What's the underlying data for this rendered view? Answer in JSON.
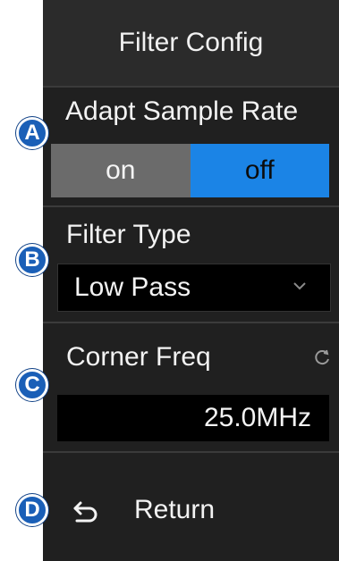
{
  "header": {
    "title": "Filter Config"
  },
  "markers": {
    "a": "A",
    "b": "B",
    "c": "C",
    "d": "D"
  },
  "adapt_sample_rate": {
    "label": "Adapt Sample Rate",
    "options": {
      "on": "on",
      "off": "off"
    },
    "selected": "off"
  },
  "filter_type": {
    "label": "Filter Type",
    "value": "Low Pass",
    "icon": "chevron-down-icon"
  },
  "corner_freq": {
    "label": "Corner Freq",
    "value": "25.0MHz",
    "icon": "reset-icon"
  },
  "return_row": {
    "label": "Return",
    "icon": "return-arrow-icon"
  },
  "colors": {
    "panel_bg": "#202020",
    "header_bg": "#2b2b2b",
    "selected_accent": "#1b84e6",
    "unselected_segment": "#6b6b6b",
    "marker_blue": "#1a5fb7"
  }
}
